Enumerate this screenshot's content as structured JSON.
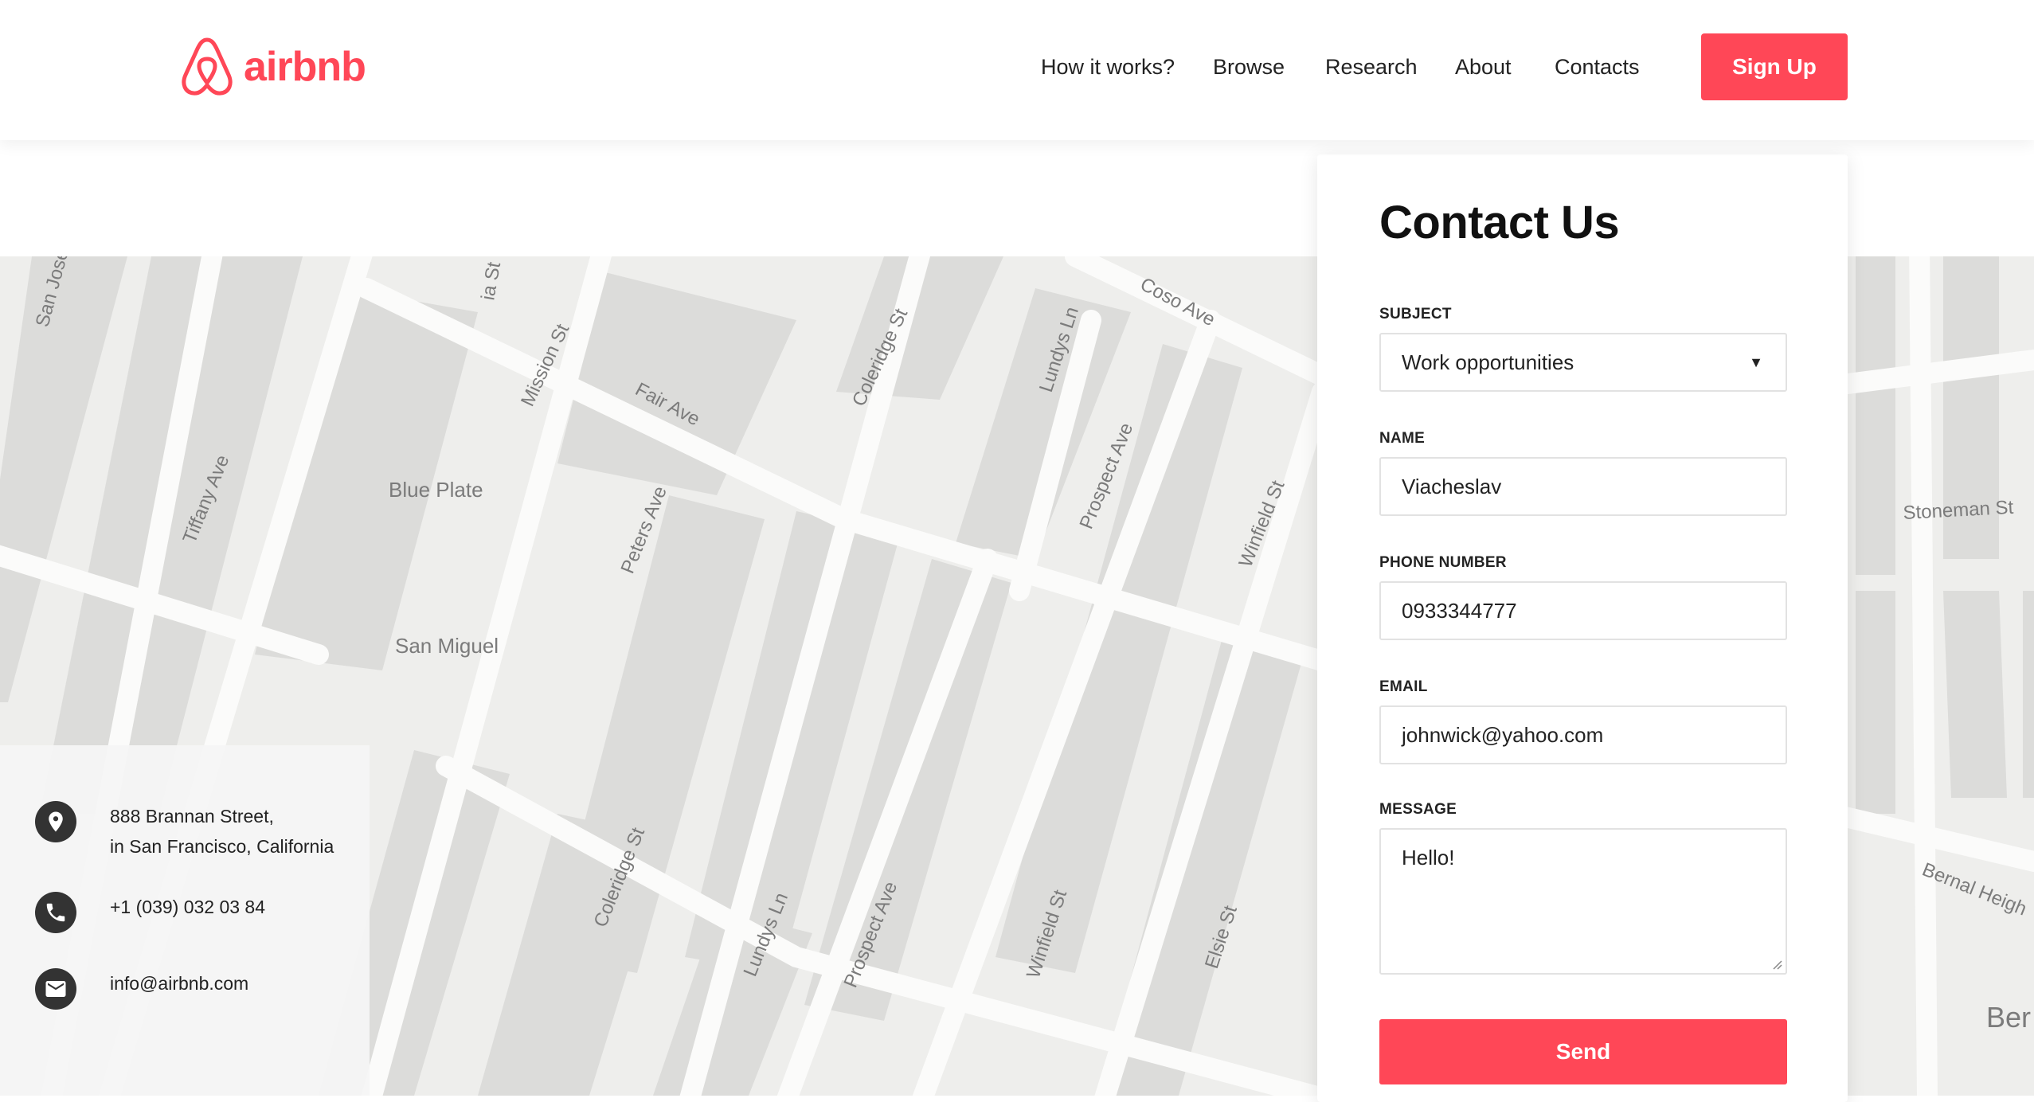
{
  "brand": {
    "name": "airbnb",
    "color": "#ff4757",
    "logo_icon": "airbnb-belo-icon"
  },
  "nav": {
    "items": [
      {
        "label": "How it works?"
      },
      {
        "label": "Browse"
      },
      {
        "label": "Research"
      },
      {
        "label": "About"
      },
      {
        "label": "Contacts"
      }
    ],
    "signup_label": "Sign Up"
  },
  "map": {
    "street_labels": [
      "San Jose",
      "Mission St",
      "Fair Ave",
      "Coleridge St",
      "Lundys Ln",
      "Coso Ave",
      "Tiffany Ave",
      "Peters Ave",
      "Prospect Ave",
      "Winfield St",
      "Stoneman St",
      "Coleridge St",
      "Lundys Ln",
      "Prospect Ave",
      "Winfield St",
      "Elsie St",
      "Bernal Heigh",
      "ia St"
    ],
    "place_labels": [
      "Blue Plate",
      "San Miguel",
      "Ber"
    ]
  },
  "contact_info": {
    "address_line1": "888 Brannan Street,",
    "address_line2": "in San Francisco, California",
    "phone": "+1 (039) 032 03 84",
    "email": "info@airbnb.com",
    "icons": [
      "location-pin-icon",
      "phone-icon",
      "mail-icon"
    ]
  },
  "form": {
    "title": "Contact Us",
    "subject_label": "SUBJECT",
    "subject_value": "Work opportunities",
    "name_label": "NAME",
    "name_value": "Viacheslav",
    "phone_label": "PHONE NUMBER",
    "phone_value": "0933344777",
    "email_label": "EMAIL",
    "email_value": "johnwick@yahoo.com",
    "message_label": "MESSAGE",
    "message_value": "Hello!",
    "send_label": "Send"
  }
}
